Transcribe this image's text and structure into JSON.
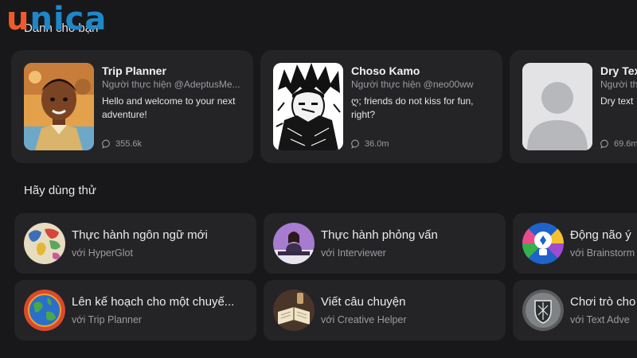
{
  "logo": {
    "first_letter": "u",
    "rest": "nica"
  },
  "sections": {
    "for_you": "Dành cho bạn",
    "try_it": "Hãy dùng thử"
  },
  "characters": [
    {
      "name": "Trip Planner",
      "creator": "Người thực hiện @AdeptusMe...",
      "greeting": "Hello and welcome to your next adventure!",
      "chats": "355.6k"
    },
    {
      "name": "Choso Kamo",
      "creator": "Người thực hiện @neo00ww",
      "greeting": "ღ; friends do not kiss for fun, right?",
      "chats": "36.0m"
    },
    {
      "name": "Dry Tex",
      "creator": "Người th",
      "greeting": "Dry text",
      "chats": "69.6m"
    }
  ],
  "tasks": [
    {
      "title": "Thực hành ngôn ngữ mới",
      "sub": "với HyperGlot"
    },
    {
      "title": "Thực hành phỏng vấn",
      "sub": "với Interviewer"
    },
    {
      "title": "Động não ý",
      "sub": "với Brainstorm"
    },
    {
      "title": "Lên kế hoạch cho một chuyế...",
      "sub": "với Trip Planner"
    },
    {
      "title": "Viết câu chuyện",
      "sub": "với Creative Helper"
    },
    {
      "title": "Chơi trò cho",
      "sub": "với Text Adve"
    }
  ]
}
